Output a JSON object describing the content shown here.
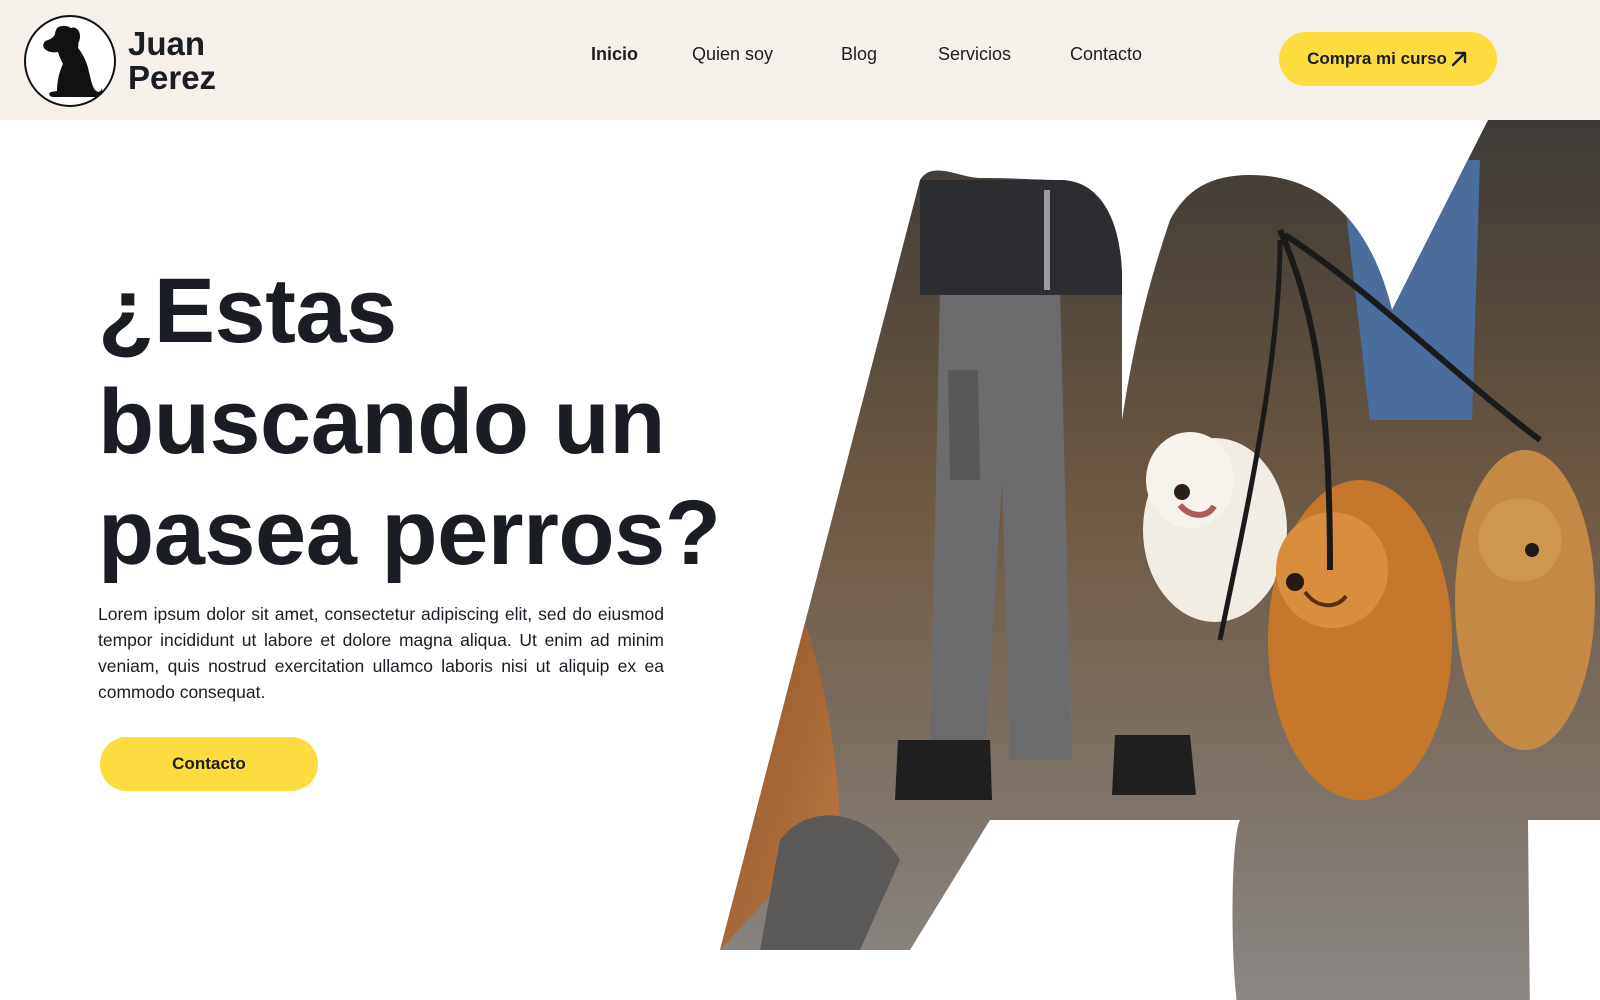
{
  "brand": {
    "name_line1": "Juan",
    "name_line2": "Perez",
    "logo_icon": "sitting-dog-icon"
  },
  "nav": {
    "items": [
      {
        "label": "Inicio",
        "active": true
      },
      {
        "label": "Quien soy",
        "active": false
      },
      {
        "label": "Blog",
        "active": false
      },
      {
        "label": "Servicios",
        "active": false
      },
      {
        "label": "Contacto",
        "active": false
      }
    ],
    "cta_label": "Compra mi curso",
    "cta_icon": "arrow-up-right-icon"
  },
  "hero": {
    "title_line1": "¿Estas",
    "title_line2": "buscando un",
    "title_line3": "pasea perros?",
    "body": "Lorem ipsum dolor sit amet, consectetur adipiscing elit, sed do eiusmod tempor incididunt ut labore et dolore magna aliqua. Ut enim ad minim veniam, quis nostrud exercitation ullamco laboris nisi ut aliquip ex ea commodo consequat.",
    "cta_label": "Contacto",
    "image_subject": "person-walking-dogs-image"
  },
  "colors": {
    "header_bg": "#f5f1ea",
    "accent": "#fedb3f",
    "text": "#1b1d24",
    "page_bg": "#ffffff"
  }
}
